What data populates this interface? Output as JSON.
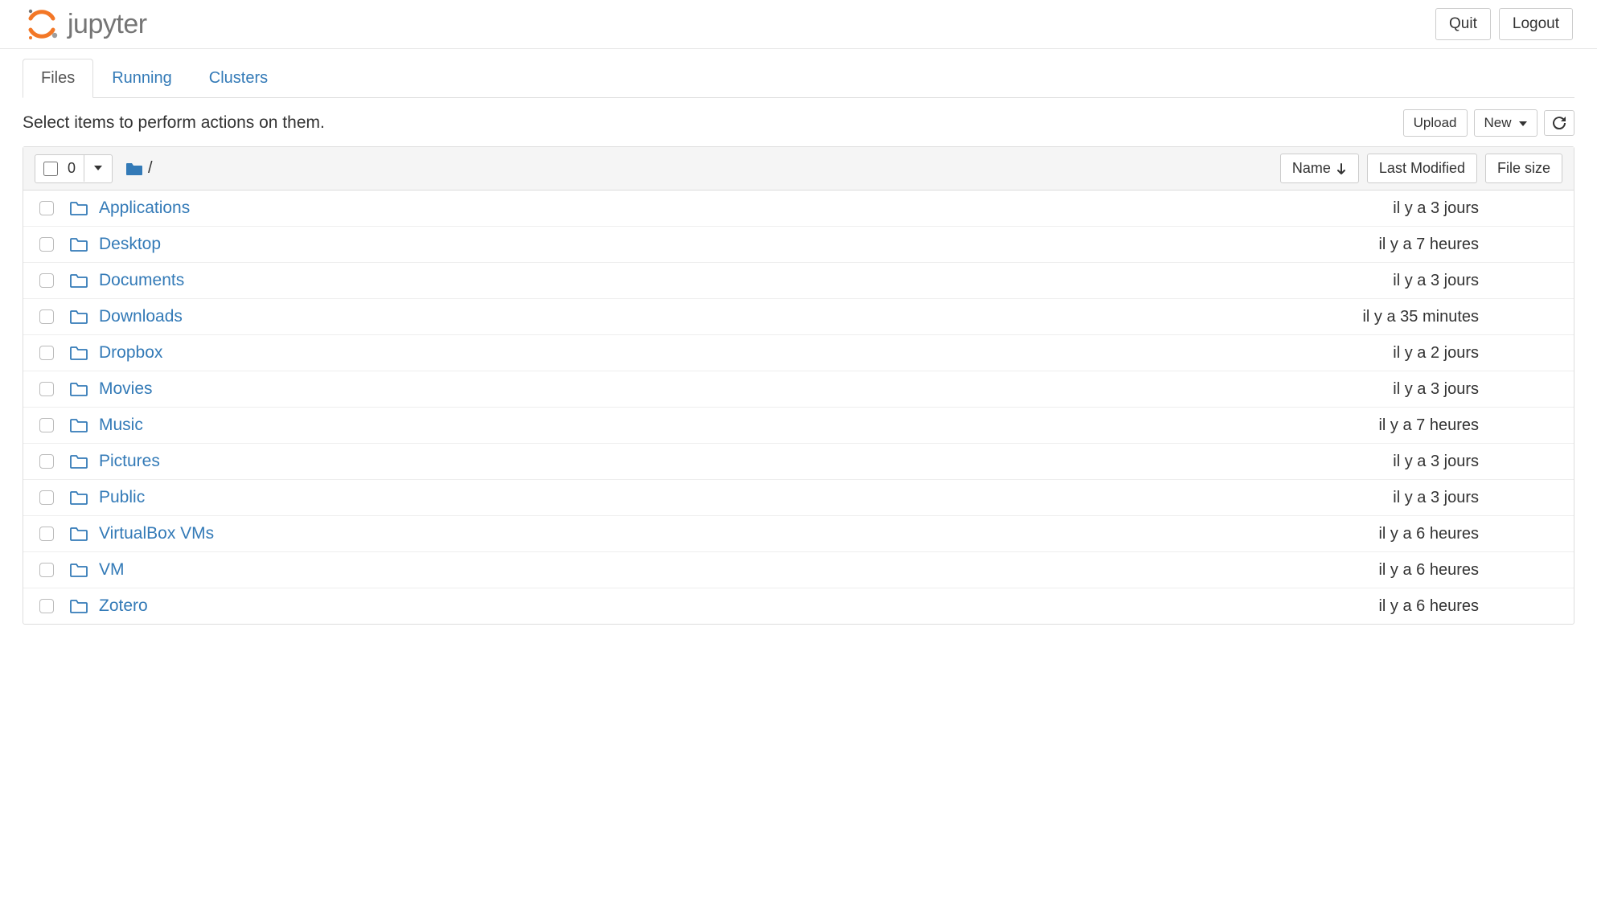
{
  "header": {
    "logo_text": "jupyter",
    "quit_label": "Quit",
    "logout_label": "Logout"
  },
  "tabs": {
    "files": "Files",
    "running": "Running",
    "clusters": "Clusters"
  },
  "toolbar": {
    "hint": "Select items to perform actions on them.",
    "upload_label": "Upload",
    "new_label": "New"
  },
  "list_header": {
    "selected_count": "0",
    "breadcrumb_root": "/",
    "name_label": "Name",
    "last_modified_label": "Last Modified",
    "file_size_label": "File size"
  },
  "items": [
    {
      "name": "Applications",
      "modified": "il y a 3 jours"
    },
    {
      "name": "Desktop",
      "modified": "il y a 7 heures"
    },
    {
      "name": "Documents",
      "modified": "il y a 3 jours"
    },
    {
      "name": "Downloads",
      "modified": "il y a 35 minutes"
    },
    {
      "name": "Dropbox",
      "modified": "il y a 2 jours"
    },
    {
      "name": "Movies",
      "modified": "il y a 3 jours"
    },
    {
      "name": "Music",
      "modified": "il y a 7 heures"
    },
    {
      "name": "Pictures",
      "modified": "il y a 3 jours"
    },
    {
      "name": "Public",
      "modified": "il y a 3 jours"
    },
    {
      "name": "VirtualBox VMs",
      "modified": "il y a 6 heures"
    },
    {
      "name": "VM",
      "modified": "il y a 6 heures"
    },
    {
      "name": "Zotero",
      "modified": "il y a 6 heures"
    }
  ]
}
